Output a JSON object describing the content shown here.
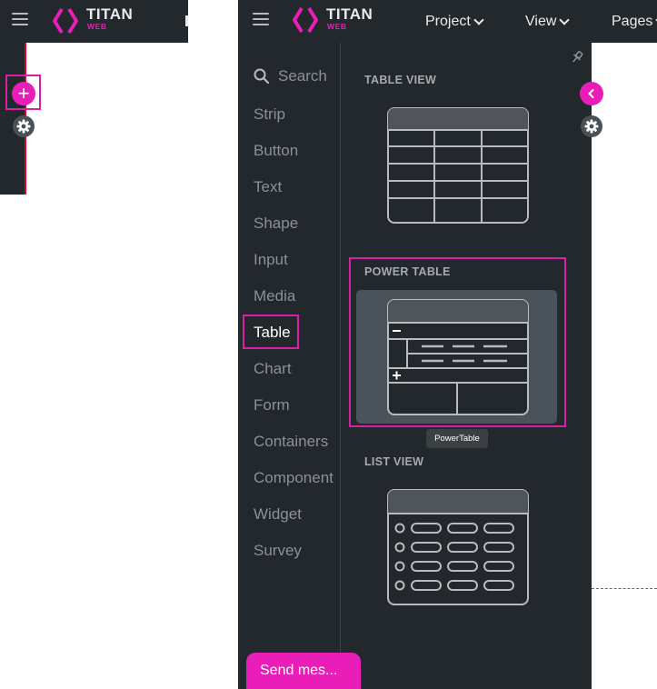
{
  "app": {
    "brand_name": "TITAN",
    "brand_sub": "WEB",
    "accent_color": "#e91eb8",
    "highlight_color": "#d81fa6"
  },
  "header": {
    "menus": [
      {
        "label": "Project"
      },
      {
        "label": "View"
      },
      {
        "label": "Pages"
      }
    ]
  },
  "sidebar": {
    "search_placeholder": "Search",
    "categories": [
      {
        "label": "Strip"
      },
      {
        "label": "Button"
      },
      {
        "label": "Text"
      },
      {
        "label": "Shape"
      },
      {
        "label": "Input"
      },
      {
        "label": "Media"
      },
      {
        "label": "Table",
        "active": true
      },
      {
        "label": "Chart"
      },
      {
        "label": "Form"
      },
      {
        "label": "Containers"
      },
      {
        "label": "Component"
      },
      {
        "label": "Widget"
      },
      {
        "label": "Survey"
      }
    ]
  },
  "panel": {
    "sections": [
      {
        "title": "TABLE VIEW",
        "icon": "table-view-icon"
      },
      {
        "title": "POWER TABLE",
        "icon": "power-table-icon",
        "selected": true
      },
      {
        "title": "LIST VIEW",
        "icon": "list-view-icon"
      }
    ],
    "tooltip": "PowerTable"
  },
  "chat": {
    "send_label": "Send mes..."
  }
}
